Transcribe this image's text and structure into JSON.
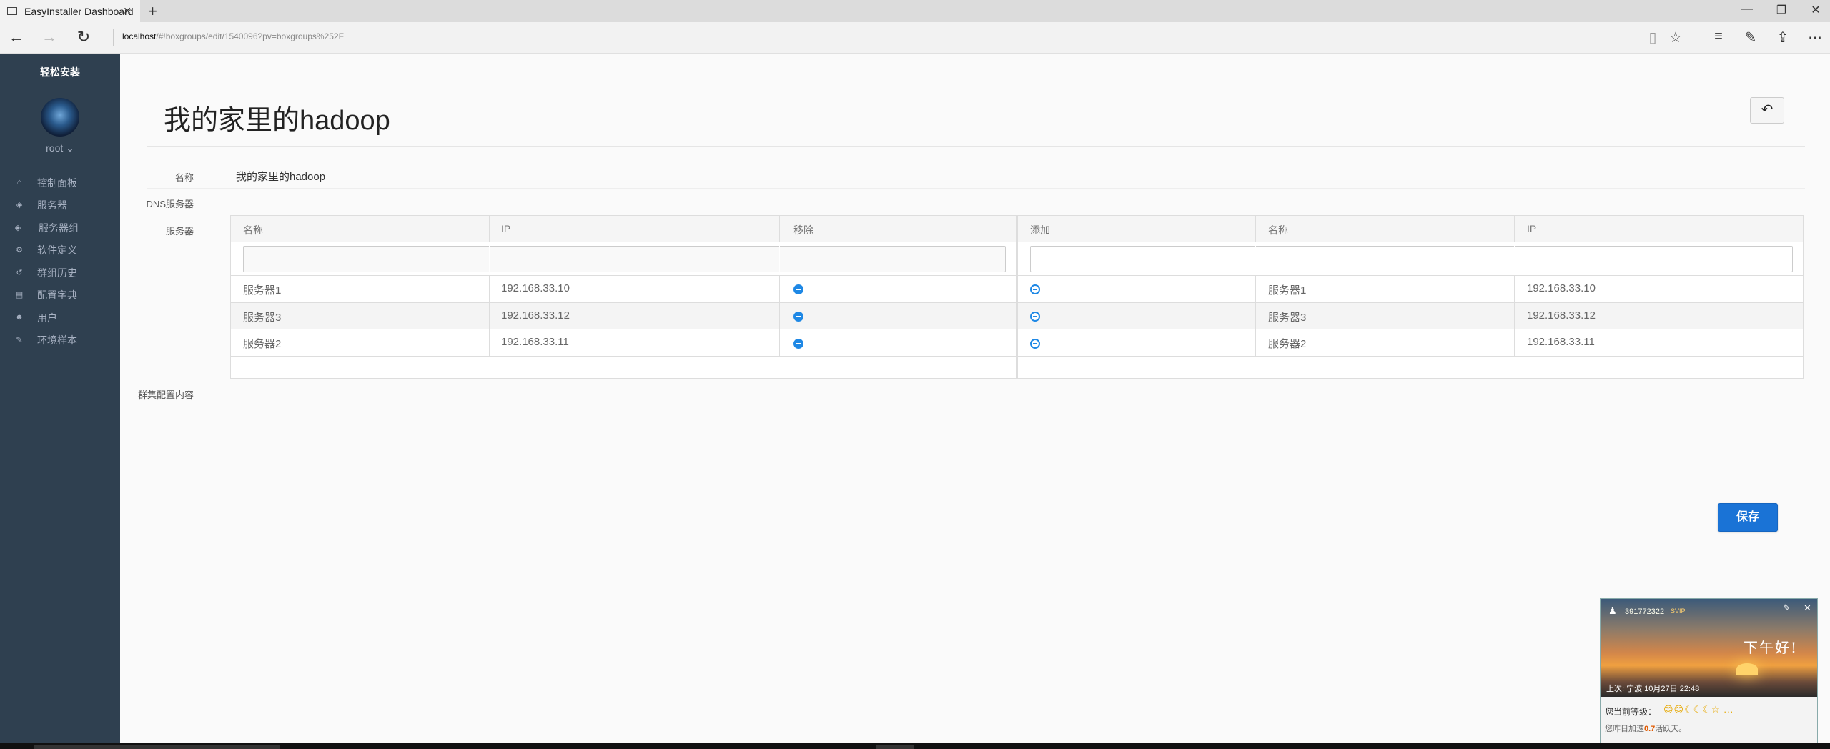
{
  "browser": {
    "tab_title": "EasyInstaller Dashboard",
    "url_host": "localhost",
    "url_path": "/#!boxgroups/edit/1540096?pv=boxgroups%252F"
  },
  "sidebar": {
    "brand": "轻松安装",
    "user": "root ⌄",
    "items": [
      {
        "label": "控制面板",
        "icon": "dashboard-icon"
      },
      {
        "label": "服务器",
        "icon": "cube-icon"
      },
      {
        "label": "服务器组",
        "icon": "cubes-icon"
      },
      {
        "label": "软件定义",
        "icon": "cogs-icon"
      },
      {
        "label": "群组历史",
        "icon": "history-icon"
      },
      {
        "label": "配置字典",
        "icon": "book-icon"
      },
      {
        "label": "用户",
        "icon": "users-icon"
      },
      {
        "label": "环境样本",
        "icon": "wrench-icon"
      }
    ]
  },
  "main": {
    "title": "我的家里的hadoop",
    "name_label": "名称",
    "name_value": "我的家里的hadoop",
    "dns_label": "DNS服务器",
    "servers_label": "服务器",
    "cluster_label": "群集配置内容",
    "save_label": "保存",
    "left_table": {
      "headers": [
        "名称",
        "IP",
        "移除"
      ],
      "rows": [
        {
          "name": "服务器1",
          "ip": "192.168.33.10"
        },
        {
          "name": "服务器3",
          "ip": "192.168.33.12"
        },
        {
          "name": "服务器2",
          "ip": "192.168.33.11"
        }
      ]
    },
    "right_table": {
      "headers": [
        "添加",
        "名称",
        "IP"
      ],
      "rows": [
        {
          "name": "服务器1",
          "ip": "192.168.33.10"
        },
        {
          "name": "服务器3",
          "ip": "192.168.33.12"
        },
        {
          "name": "服务器2",
          "ip": "192.168.33.11"
        }
      ]
    }
  },
  "qq_popup": {
    "qq_id": "391772322",
    "vip": "SVIP",
    "greeting": "下午好!",
    "last_login": "上次: 宁波 10月27日 22:48",
    "level_label": "您当前等级：",
    "level_icons": "😊😊☾☾☾☆ ...",
    "speed_prefix": "您昨日加速",
    "speed_value": "0.7",
    "speed_suffix": "活跃天。"
  }
}
